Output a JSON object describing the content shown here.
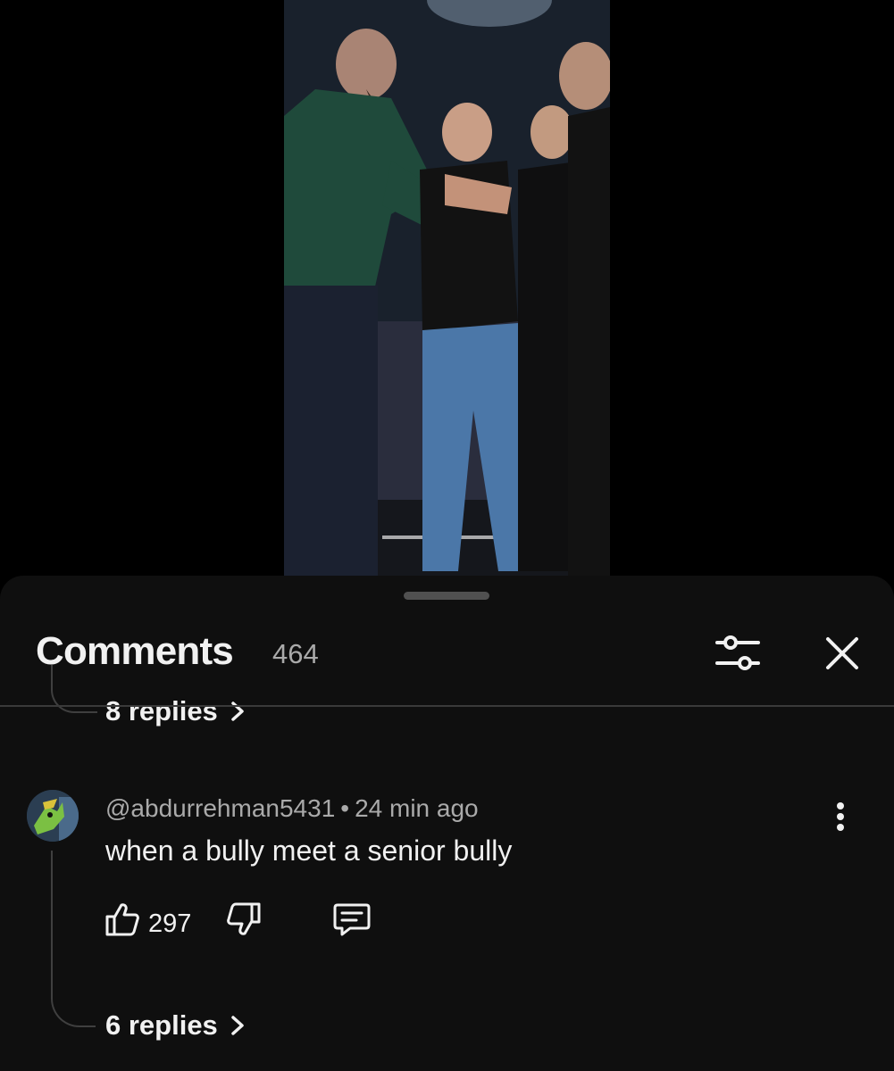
{
  "video": {
    "description_icon": "video-frame"
  },
  "comments_sheet": {
    "title": "Comments",
    "count": "464",
    "filter_icon": "filter-sliders-icon",
    "close_icon": "close-icon"
  },
  "previous_thread": {
    "replies_label": "8 replies"
  },
  "comment": {
    "author": "@abdurrehman5431",
    "separator": "•",
    "time": "24 min ago",
    "text": "when a bully meet a senior bully",
    "likes": "297",
    "replies_label": "6 replies",
    "avatar_icon": "avatar-icon"
  },
  "colors": {
    "sheet_bg": "#0f0f0f",
    "text_primary": "#f1f1f1",
    "text_secondary": "#aaaaaa",
    "divider": "#3a3a3a"
  }
}
